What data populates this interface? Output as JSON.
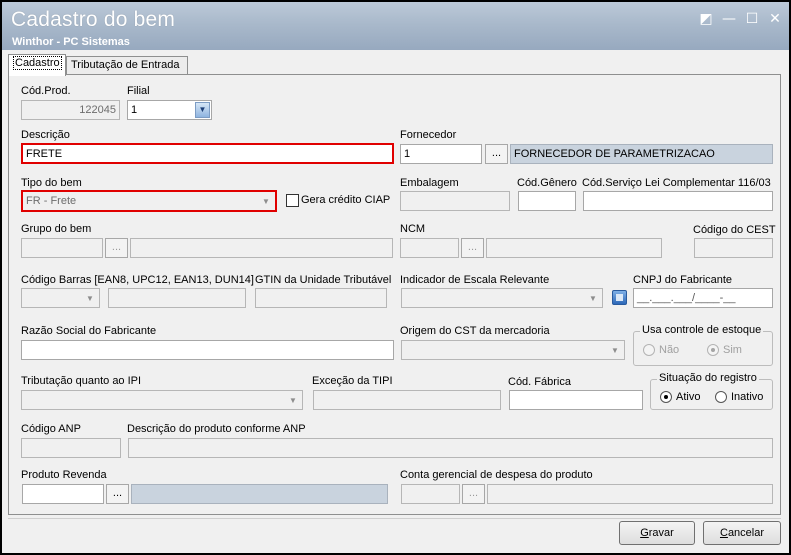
{
  "window": {
    "title": "Cadastro do bem",
    "subtitle": "Winthor - PC Sistemas",
    "controls": {
      "restore": "◩",
      "minimize": "—",
      "maximize": "☐",
      "close": "✕"
    }
  },
  "tabs": [
    {
      "label": "Cadastro",
      "active": true
    },
    {
      "label": "Tributação de Entrada",
      "active": false
    }
  ],
  "form": {
    "cod_prod": {
      "label": "Cód.Prod.",
      "value": "122045"
    },
    "filial": {
      "label": "Filial",
      "value": "1"
    },
    "descricao": {
      "label": "Descrição",
      "value": "FRETE"
    },
    "fornecedor": {
      "label": "Fornecedor",
      "code": "1",
      "button": "...",
      "name": "FORNECEDOR DE PARAMETRIZACAO"
    },
    "tipo_bem": {
      "label": "Tipo do bem",
      "value": "FR - Frete"
    },
    "gera_credito": {
      "label": "Gera crédito CIAP",
      "checked": false
    },
    "embalagem": {
      "label": "Embalagem",
      "value": ""
    },
    "cod_genero": {
      "label": "Cód.Gênero",
      "value": ""
    },
    "cod_servico": {
      "label": "Cód.Serviço Lei Complementar 116/03",
      "value": ""
    },
    "grupo_bem": {
      "label": "Grupo do bem",
      "button": "..."
    },
    "ncm": {
      "label": "NCM",
      "button": "..."
    },
    "codigo_cest": {
      "label": "Código do CEST",
      "value": ""
    },
    "codigo_barras": {
      "label": "Código Barras [EAN8, UPC12, EAN13, DUN14]"
    },
    "gtin": {
      "label": "GTIN da Unidade Tributável"
    },
    "indicador_escala": {
      "label": "Indicador de Escala Relevante"
    },
    "cnpj_fabricante": {
      "label": "CNPJ do Fabricante",
      "mask": "__.___.___/____-__"
    },
    "razao_social": {
      "label": "Razão Social do Fabricante",
      "value": ""
    },
    "origem_cst": {
      "label": "Origem do CST da mercadoria"
    },
    "controle_estoque": {
      "label": "Usa controle de estoque",
      "options": [
        {
          "label": "Não",
          "selected": false
        },
        {
          "label": "Sim",
          "selected": true
        }
      ]
    },
    "tributacao_ipi": {
      "label": "Tributação quanto ao IPI"
    },
    "excecao_tipi": {
      "label": "Exceção da TIPI"
    },
    "cod_fabrica": {
      "label": "Cód. Fábrica",
      "value": ""
    },
    "situacao_registro": {
      "label": "Situação do registro",
      "options": [
        {
          "label": "Ativo",
          "selected": true
        },
        {
          "label": "Inativo",
          "selected": false
        }
      ]
    },
    "codigo_anp": {
      "label": "Código ANP"
    },
    "descricao_anp": {
      "label": "Descrição do produto conforme ANP"
    },
    "produto_revenda": {
      "label": "Produto Revenda",
      "button": "..."
    },
    "conta_gerencial": {
      "label": "Conta gerencial de despesa do produto",
      "button": "..."
    }
  },
  "buttons": {
    "gravar": {
      "accel": "G",
      "rest": "ravar"
    },
    "cancelar": {
      "accel": "C",
      "rest": "ancelar"
    }
  },
  "colors": {
    "title_gradient_top": "#bcc9d8",
    "title_gradient_bottom": "#97a9bf",
    "highlight_red": "#e00000",
    "readonly_blue": "#c9d3de"
  }
}
